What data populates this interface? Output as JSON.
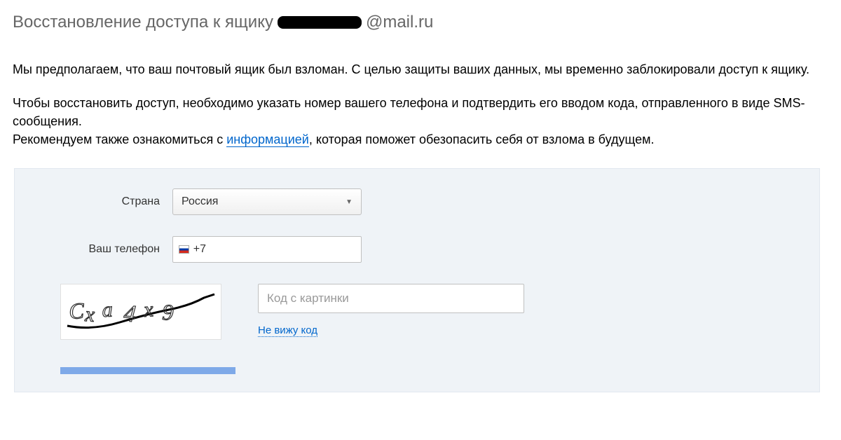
{
  "title_prefix": "Восстановление доступа к ящику ",
  "title_suffix": "@mail.ru",
  "paragraph1": "Мы предполагаем, что ваш почтовый ящик был взломан. С целью защиты ваших данных, мы временно заблокировали доступ к ящику.",
  "paragraph2a": "Чтобы восстановить доступ, необходимо указать номер вашего телефона и подтвердить его вводом кода, отправленного в виде SMS-сообщения.",
  "paragraph2b_pre": "Рекомендуем также ознакомиться с ",
  "info_link": "информацией",
  "paragraph2b_post": ", которая поможет обезопасить себя от взлома в будущем.",
  "form": {
    "country_label": "Страна",
    "country_value": "Россия",
    "phone_label": "Ваш телефон",
    "phone_prefix": "+7",
    "phone_value": "",
    "captcha_text": "Cxa4x9",
    "captcha_placeholder": "Код с картинки",
    "captcha_value": "",
    "refresh_captcha": "Не вижу код"
  }
}
